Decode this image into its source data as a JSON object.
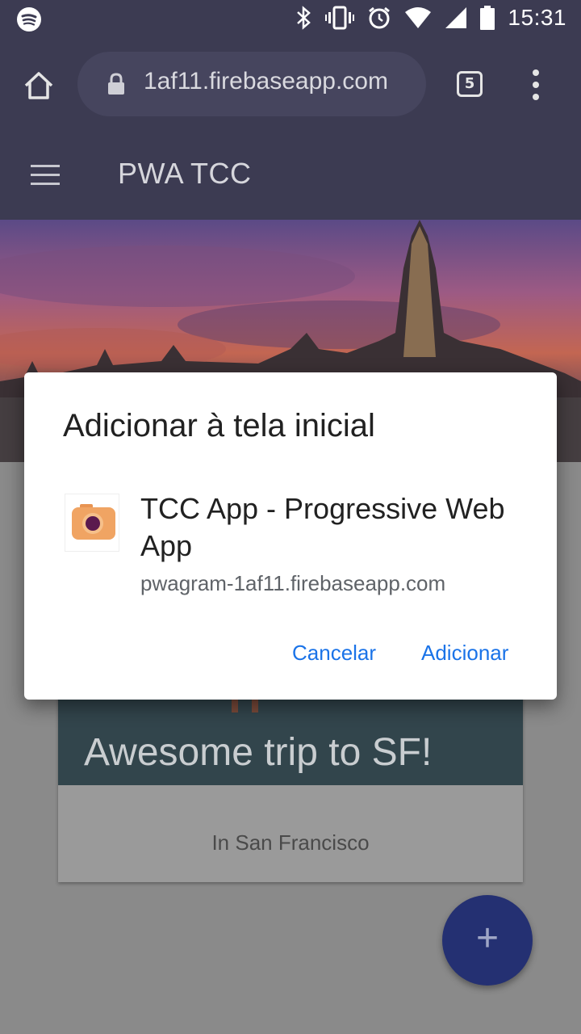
{
  "status_bar": {
    "time": "15:31",
    "icons": [
      "spotify-icon",
      "bluetooth-icon",
      "vibrate-icon",
      "alarm-icon",
      "wifi-icon",
      "signal-icon",
      "battery-icon"
    ]
  },
  "browser": {
    "url": "1af11.firebaseapp.com",
    "tab_count": "5",
    "icons": [
      "home-icon",
      "lock-icon",
      "tabs-icon",
      "overflow-menu-icon"
    ]
  },
  "app": {
    "title": "PWA TCC"
  },
  "card": {
    "title": "Awesome trip to SF!",
    "location": "In San Francisco"
  },
  "fab": {
    "label": "+"
  },
  "dialog": {
    "title": "Adicionar à tela inicial",
    "app_name": "TCC App - Progressive Web App",
    "app_url": "pwagram-1af11.firebaseapp.com",
    "cancel_label": "Cancelar",
    "add_label": "Adicionar"
  },
  "colors": {
    "toolbar": "#3c3b52",
    "accent": "#1a73e8",
    "fab": "#243072",
    "app_icon": "#f0a463"
  }
}
